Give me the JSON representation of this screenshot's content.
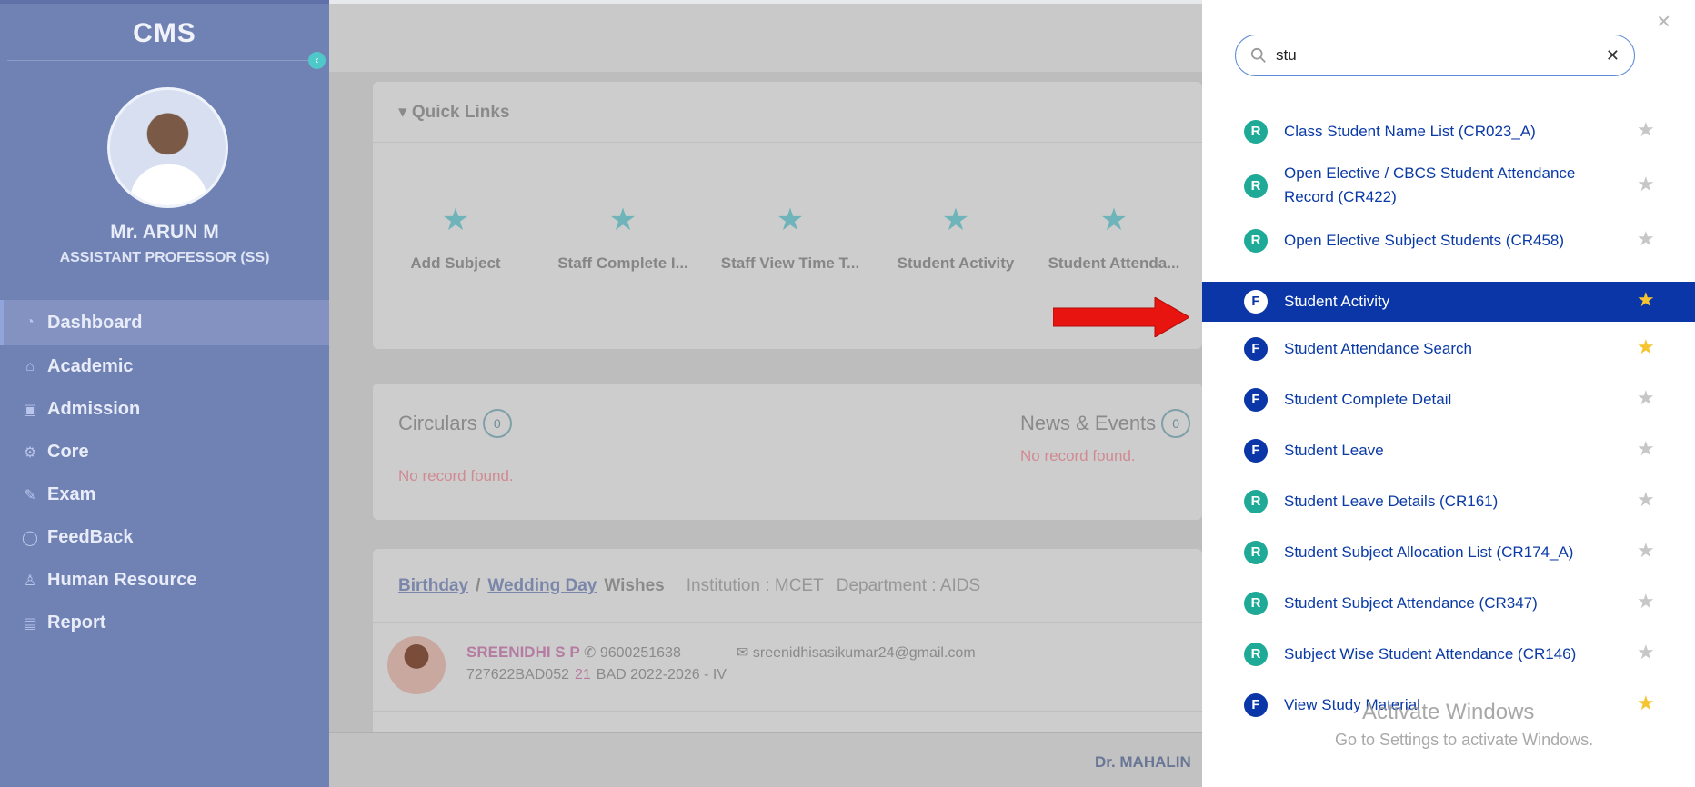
{
  "sidebar": {
    "brand": "CMS",
    "collapse_icon": "chevron-left-icon",
    "user_name": "Mr. ARUN M",
    "user_role": "ASSISTANT PROFESSOR (SS)",
    "items": [
      {
        "label": "Dashboard",
        "icon": "pie-chart-icon",
        "active": true
      },
      {
        "label": "Academic",
        "icon": "graduation-cap-icon"
      },
      {
        "label": "Admission",
        "icon": "id-card-icon"
      },
      {
        "label": "Core",
        "icon": "gear-icon"
      },
      {
        "label": "Exam",
        "icon": "edit-icon"
      },
      {
        "label": "FeedBack",
        "icon": "chat-icon"
      },
      {
        "label": "Human Resource",
        "icon": "user-plus-icon"
      },
      {
        "label": "Report",
        "icon": "report-icon"
      }
    ]
  },
  "quick_links": {
    "title": "Quick Links",
    "items": [
      {
        "label": "Add Subject"
      },
      {
        "label": "Staff Complete I..."
      },
      {
        "label": "Staff View Time T..."
      },
      {
        "label": "Student Activity"
      },
      {
        "label": "Student Attenda..."
      }
    ]
  },
  "circulars": {
    "title": "Circulars",
    "count": "0",
    "empty": "No record found."
  },
  "news": {
    "title": "News & Events",
    "count": "0",
    "empty": "No record found."
  },
  "wishes": {
    "birthday": "Birthday",
    "separator": "/",
    "wedding": "Wedding Day",
    "wishes": "Wishes",
    "institution": "Institution :  MCET",
    "department": "Department : AIDS",
    "person": {
      "name": "SREENIDHI S P",
      "phone": "9600251638",
      "email": "sreenidhisasikumar24@gmail.com",
      "reg": "727622BAD052",
      "num": "21",
      "batch": "BAD 2022-2026 - IV"
    }
  },
  "footer": {
    "text": "Dr. MAHALIN"
  },
  "search": {
    "value": "stu",
    "results": [
      {
        "type": "R",
        "label": "Class Student Name List (CR023_A)",
        "fav": false
      },
      {
        "type": "R",
        "label": "Open Elective / CBCS Student Attendance Record (CR422)",
        "fav": false
      },
      {
        "type": "R",
        "label": "Open Elective Subject Students (CR458)",
        "fav": false
      },
      {
        "type": "F",
        "label": "Student Activity",
        "fav": true,
        "active": true
      },
      {
        "type": "F",
        "label": "Student Attendance Search",
        "fav": true
      },
      {
        "type": "F",
        "label": "Student Complete Detail",
        "fav": false
      },
      {
        "type": "F",
        "label": "Student Leave",
        "fav": false
      },
      {
        "type": "R",
        "label": "Student Leave Details (CR161)",
        "fav": false
      },
      {
        "type": "R",
        "label": "Student Subject Allocation List (CR174_A)",
        "fav": false
      },
      {
        "type": "R",
        "label": "Student Subject Attendance (CR347)",
        "fav": false
      },
      {
        "type": "R",
        "label": "Subject Wise Student Attendance (CR146)",
        "fav": false
      },
      {
        "type": "F",
        "label": "View Study Material",
        "fav": true
      }
    ]
  },
  "watermark": {
    "line1": "Activate Windows",
    "line2": "Go to Settings to activate Windows."
  },
  "colors": {
    "sidebar": "#7081b4",
    "active_result": "#0a36a8",
    "report_badge": "#1faa98",
    "fav_star": "#f4c431",
    "arrow": "#e8140f"
  }
}
